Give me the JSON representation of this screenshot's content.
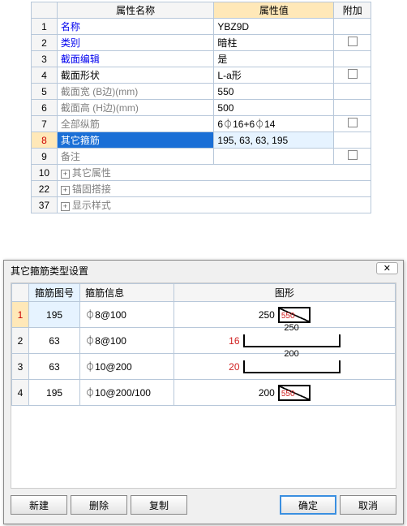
{
  "prop_header": {
    "name": "属性名称",
    "value": "属性值",
    "extra": "附加"
  },
  "props": [
    {
      "n": "1",
      "name": "名称",
      "value": "YBZ9D",
      "link": true,
      "chk": false,
      "gray": false
    },
    {
      "n": "2",
      "name": "类别",
      "value": "暗柱",
      "link": true,
      "chk": true,
      "gray": false
    },
    {
      "n": "3",
      "name": "截面编辑",
      "value": "是",
      "link": true,
      "chk": false,
      "gray": false
    },
    {
      "n": "4",
      "name": "截面形状",
      "value": "L-a形",
      "link": false,
      "chk": true,
      "gray": false
    },
    {
      "n": "5",
      "name": "截面宽 (B边)(mm)",
      "value": "550",
      "link": false,
      "chk": false,
      "gray": true
    },
    {
      "n": "6",
      "name": "截面高 (H边)(mm)",
      "value": "500",
      "link": false,
      "chk": false,
      "gray": true
    },
    {
      "n": "7",
      "name": "全部纵筋",
      "value": "6⏀16+6⏀14",
      "link": false,
      "chk": true,
      "gray": true
    },
    {
      "n": "8",
      "name": "其它箍筋",
      "value": "195, 63, 63, 195",
      "link": false,
      "chk": false,
      "gray": false,
      "selected": true
    },
    {
      "n": "9",
      "name": "备注",
      "value": "",
      "link": false,
      "chk": true,
      "gray": true
    }
  ],
  "prop_groups": [
    {
      "n": "10",
      "label": "其它属性"
    },
    {
      "n": "22",
      "label": "锚固搭接"
    },
    {
      "n": "37",
      "label": "显示样式"
    }
  ],
  "dialog": {
    "title": "其它箍筋类型设置",
    "close": "✕",
    "header": {
      "id": "箍筋图号",
      "info": "箍筋信息",
      "shape": "图形"
    },
    "rows": [
      {
        "n": "1",
        "id": "195",
        "info": "⏀8@100",
        "left": "250",
        "leftRed": false,
        "rect": "550",
        "type": "rect",
        "selected": true
      },
      {
        "n": "2",
        "id": "63",
        "info": "⏀8@100",
        "left": "16",
        "leftRed": true,
        "ulbl": "250",
        "type": "u"
      },
      {
        "n": "3",
        "id": "63",
        "info": "⏀10@200",
        "left": "20",
        "leftRed": true,
        "ulbl": "200",
        "type": "u"
      },
      {
        "n": "4",
        "id": "195",
        "info": "⏀10@200/100",
        "left": "200",
        "leftRed": false,
        "rect": "550",
        "type": "rect"
      }
    ],
    "buttons": {
      "new": "新建",
      "del": "删除",
      "copy": "复制",
      "ok": "确定",
      "cancel": "取消"
    }
  }
}
